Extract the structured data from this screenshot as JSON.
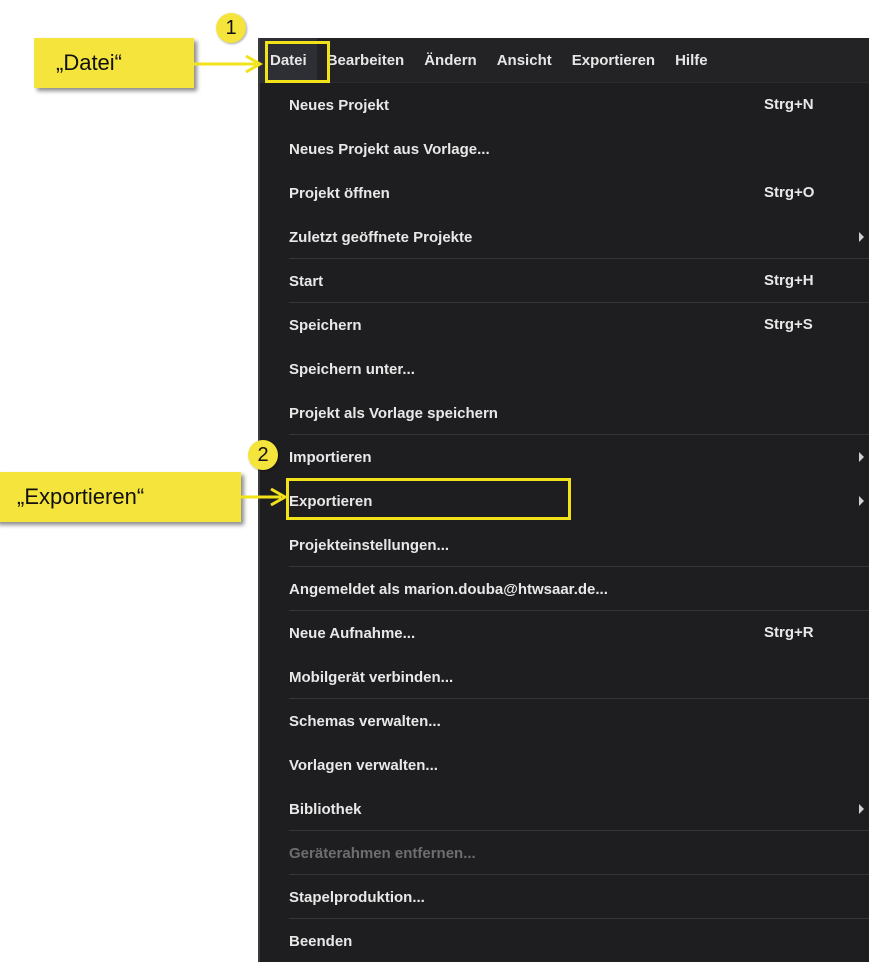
{
  "menubar": {
    "items": [
      {
        "label": "Datei"
      },
      {
        "label": "Bearbeiten"
      },
      {
        "label": "Ändern"
      },
      {
        "label": "Ansicht"
      },
      {
        "label": "Exportieren"
      },
      {
        "label": "Hilfe"
      }
    ]
  },
  "dropdown": {
    "items": [
      {
        "label": "Neues Projekt",
        "shortcut": "Strg+N"
      },
      {
        "label": "Neues Projekt aus Vorlage..."
      },
      {
        "label": "Projekt öffnen",
        "shortcut": "Strg+O"
      },
      {
        "label": "Zuletzt geöffnete Projekte"
      },
      {
        "label": "Start",
        "shortcut": "Strg+H"
      },
      {
        "label": "Speichern",
        "shortcut": "Strg+S"
      },
      {
        "label": "Speichern unter..."
      },
      {
        "label": "Projekt als Vorlage speichern"
      },
      {
        "label": "Importieren"
      },
      {
        "label": "Exportieren"
      },
      {
        "label": "Projekteinstellungen..."
      },
      {
        "label": "Angemeldet als marion.douba@htwsaar.de..."
      },
      {
        "label": "Neue Aufnahme...",
        "shortcut": "Strg+R"
      },
      {
        "label": "Mobilgerät verbinden..."
      },
      {
        "label": "Schemas verwalten..."
      },
      {
        "label": "Vorlagen verwalten..."
      },
      {
        "label": "Bibliothek"
      },
      {
        "label": "Geräterahmen entfernen..."
      },
      {
        "label": "Stapelproduktion..."
      },
      {
        "label": "Beenden"
      }
    ]
  },
  "annotations": {
    "callout1": "„Datei“",
    "callout2": "„Exportieren“",
    "badge1": "1",
    "badge2": "2"
  },
  "colors": {
    "highlight": "#f2e21a",
    "menu_bg": "#1e1e20"
  }
}
